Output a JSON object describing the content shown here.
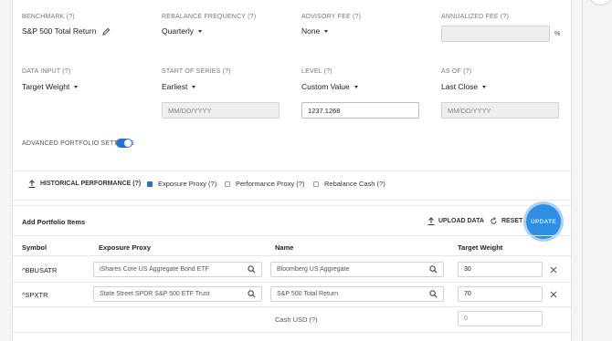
{
  "row1": {
    "benchmark": {
      "label": "BENCHMARK (?)",
      "value": "S&P 500 Total Return"
    },
    "rebalance": {
      "label": "REBALANCE FREQUENCY (?)",
      "value": "Quarterly"
    },
    "advisory": {
      "label": "ADVISORY FEE (?)",
      "value": "None"
    },
    "annualized": {
      "label": "ANNUALIZED FEE (?)",
      "value": "",
      "suffix": "%"
    }
  },
  "row2": {
    "data_input": {
      "label": "DATA INPUT (?)",
      "value": "Target Weight"
    },
    "start_series": {
      "label": "START OF SERIES (?)",
      "value": "Earliest",
      "placeholder": "MM/DD/YYYY"
    },
    "level": {
      "label": "LEVEL (?)",
      "value": "Custom Value",
      "input": "1237.1268"
    },
    "as_of": {
      "label": "AS OF (?)",
      "value": "Last Close",
      "placeholder": "MM/DD/YYYY"
    }
  },
  "advanced": {
    "label": "ADVANCED PORTFOLIO SETTINGS",
    "enabled": true
  },
  "options": {
    "historical": "HISTORICAL PERFORMANCE (?)",
    "exposure": "Exposure Proxy (?)",
    "performance": "Performance Proxy (?)",
    "rebalance_cash": "Rebalance Cash (?)"
  },
  "portfolio": {
    "title": "Add Portfolio Items",
    "upload": "UPLOAD DATA",
    "reset": "RESET",
    "update": "UPDATE",
    "columns": {
      "symbol": "Symbol",
      "exposure": "Exposure Proxy",
      "name": "Name",
      "weight": "Target Weight"
    },
    "rows": [
      {
        "symbol": "^BBUSATR",
        "exposure": "iShares Core US Aggregate Bond ETF",
        "name": "Bloomberg US Aggregate",
        "weight": "30"
      },
      {
        "symbol": "^SPXTR",
        "exposure": "State Street SPDR S&P 500 ETF Trust",
        "name": "S&P 500 Total Return",
        "weight": "70"
      }
    ],
    "cash": {
      "name": "Cash USD (?)",
      "weight": "0"
    }
  },
  "colors": {
    "accent": "#1f73d6",
    "update": "#2d8ee6"
  },
  "icons": {
    "edit": "pencil-icon",
    "search": "magnifier-icon",
    "remove": "x-icon",
    "upload": "upload-icon",
    "reset": "refresh-icon"
  }
}
